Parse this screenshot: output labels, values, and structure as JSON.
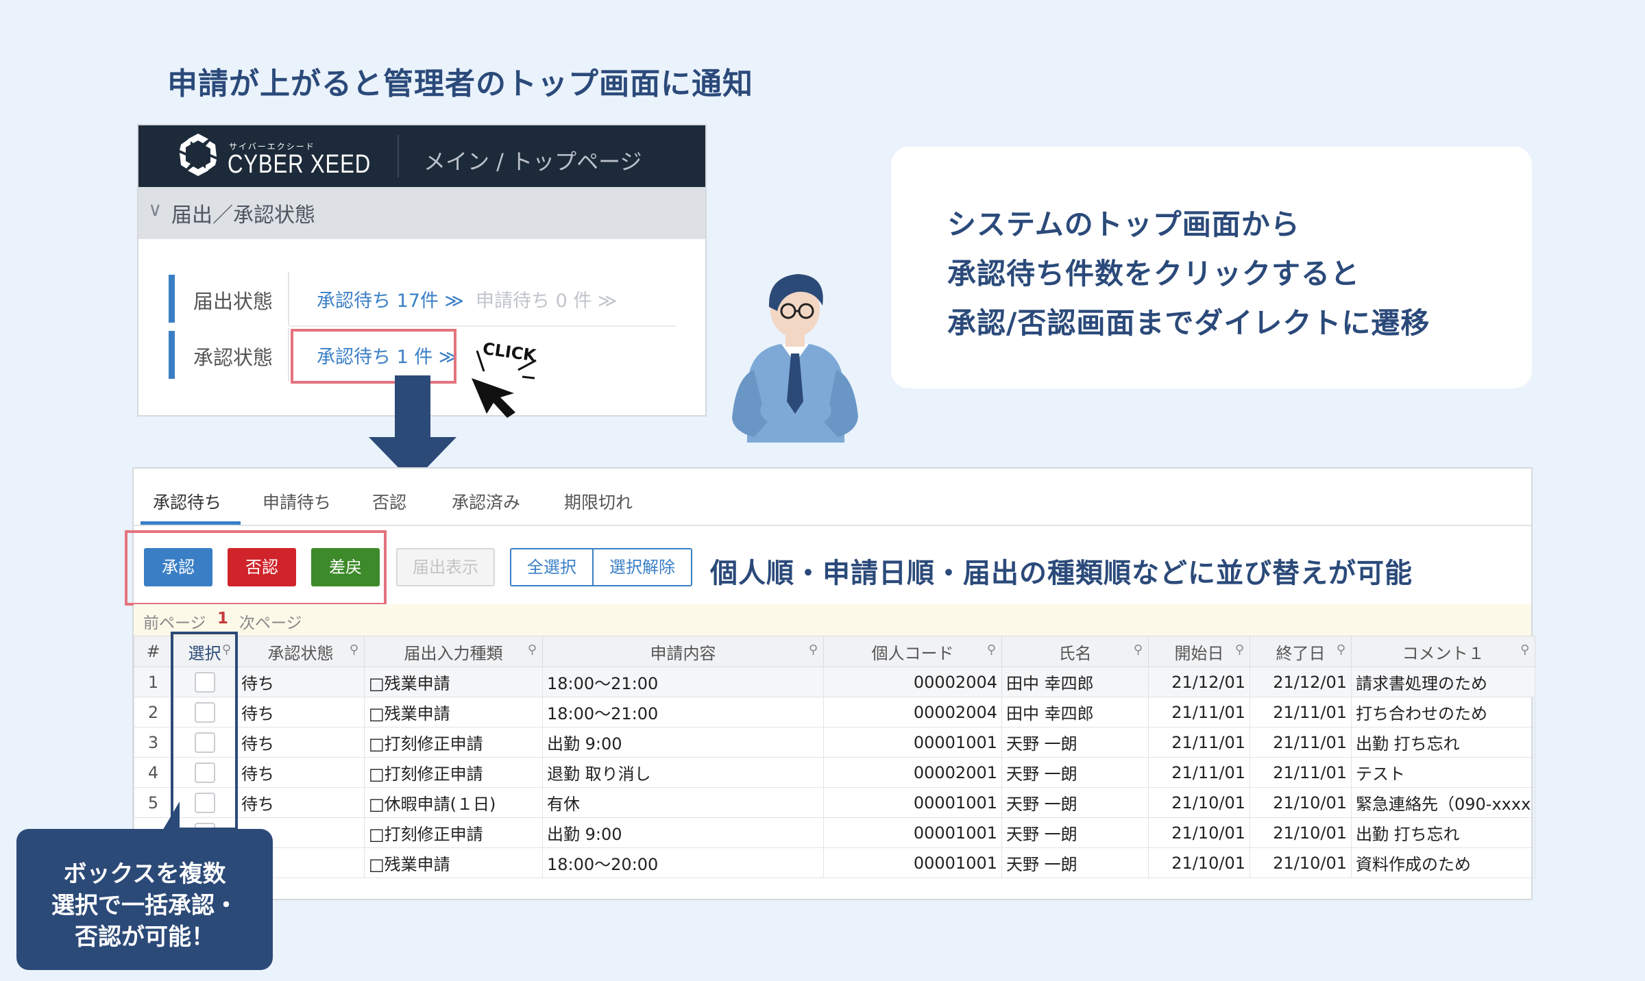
{
  "headline": "申請が上がると管理者のトップ画面に通知",
  "top_card": {
    "logo_kana": "サイバーエクシード",
    "logo_text": "CYBER XEED",
    "breadcrumb": "メイン / トップページ",
    "section_label": "届出／承認状態",
    "rows": [
      {
        "label": "届出状態",
        "link1": "承認待ち 17件 ≫",
        "link2": "申請待ち 0 件 ≫"
      },
      {
        "label": "承認状態",
        "link1": "承認待ち 1 件 ≫"
      }
    ],
    "click_label": "CLICK"
  },
  "callout": {
    "lines": [
      "システムのトップ画面から",
      "承認待ち件数をクリックすると",
      "承認/否認画面までダイレクトに遷移"
    ]
  },
  "panel": {
    "tabs": [
      "承認待ち",
      "申請待ち",
      "否認",
      "承認済み",
      "期限切れ"
    ],
    "buttons": {
      "approve": "承認",
      "reject": "否認",
      "return": "差戻",
      "show": "届出表示",
      "select_all": "全選択",
      "deselect": "選択解除"
    },
    "colors": {
      "approve": "#3a7fc6",
      "reject": "#d0232a",
      "return": "#3d8a2a"
    },
    "sort_note": "個人順・申請日順・届出の種類順などに並び替えが可能",
    "pager": {
      "prev": "前ページ",
      "current": "1",
      "next": "次ページ"
    },
    "columns": [
      "#",
      "選択",
      "承認状態",
      "届出入力種類",
      "申請内容",
      "個人コード",
      "氏名",
      "開始日",
      "終了日",
      "コメント１"
    ],
    "rows": [
      {
        "n": "1",
        "status": "待ち",
        "type": "□残業申請",
        "content": "18:00～21:00",
        "code": "00002004",
        "name": "田中 幸四郎",
        "start": "21/12/01",
        "end": "21/12/01",
        "comment": "請求書処理のため"
      },
      {
        "n": "2",
        "status": "待ち",
        "type": "□残業申請",
        "content": "18:00～21:00",
        "code": "00002004",
        "name": "田中 幸四郎",
        "start": "21/11/01",
        "end": "21/11/01",
        "comment": "打ち合わせのため"
      },
      {
        "n": "3",
        "status": "待ち",
        "type": "□打刻修正申請",
        "content": "出勤  9:00",
        "code": "00001001",
        "name": "天野 一朗",
        "start": "21/11/01",
        "end": "21/11/01",
        "comment": "出勤 打ち忘れ"
      },
      {
        "n": "4",
        "status": "待ち",
        "type": "□打刻修正申請",
        "content": "退勤 取り消し",
        "code": "00002001",
        "name": "天野 一朗",
        "start": "21/11/01",
        "end": "21/11/01",
        "comment": "テスト"
      },
      {
        "n": "5",
        "status": "待ち",
        "type": "□休暇申請(１日)",
        "content": "有休",
        "code": "00001001",
        "name": "天野 一朗",
        "start": "21/10/01",
        "end": "21/10/01",
        "comment": "緊急連絡先（090-xxxx"
      },
      {
        "n": "",
        "status": "",
        "type": "□打刻修正申請",
        "content": "出勤  9:00",
        "code": "00001001",
        "name": "天野 一朗",
        "start": "21/10/01",
        "end": "21/10/01",
        "comment": "出勤 打ち忘れ"
      },
      {
        "n": "",
        "status": "",
        "type": "□残業申請",
        "content": "18:00～20:00",
        "code": "00001001",
        "name": "天野 一朗",
        "start": "21/10/01",
        "end": "21/10/01",
        "comment": "資料作成のため"
      }
    ]
  },
  "bottom_callout": {
    "lines": [
      "ボックスを複数",
      "選択で一括承認・",
      "否認が可能！"
    ]
  }
}
